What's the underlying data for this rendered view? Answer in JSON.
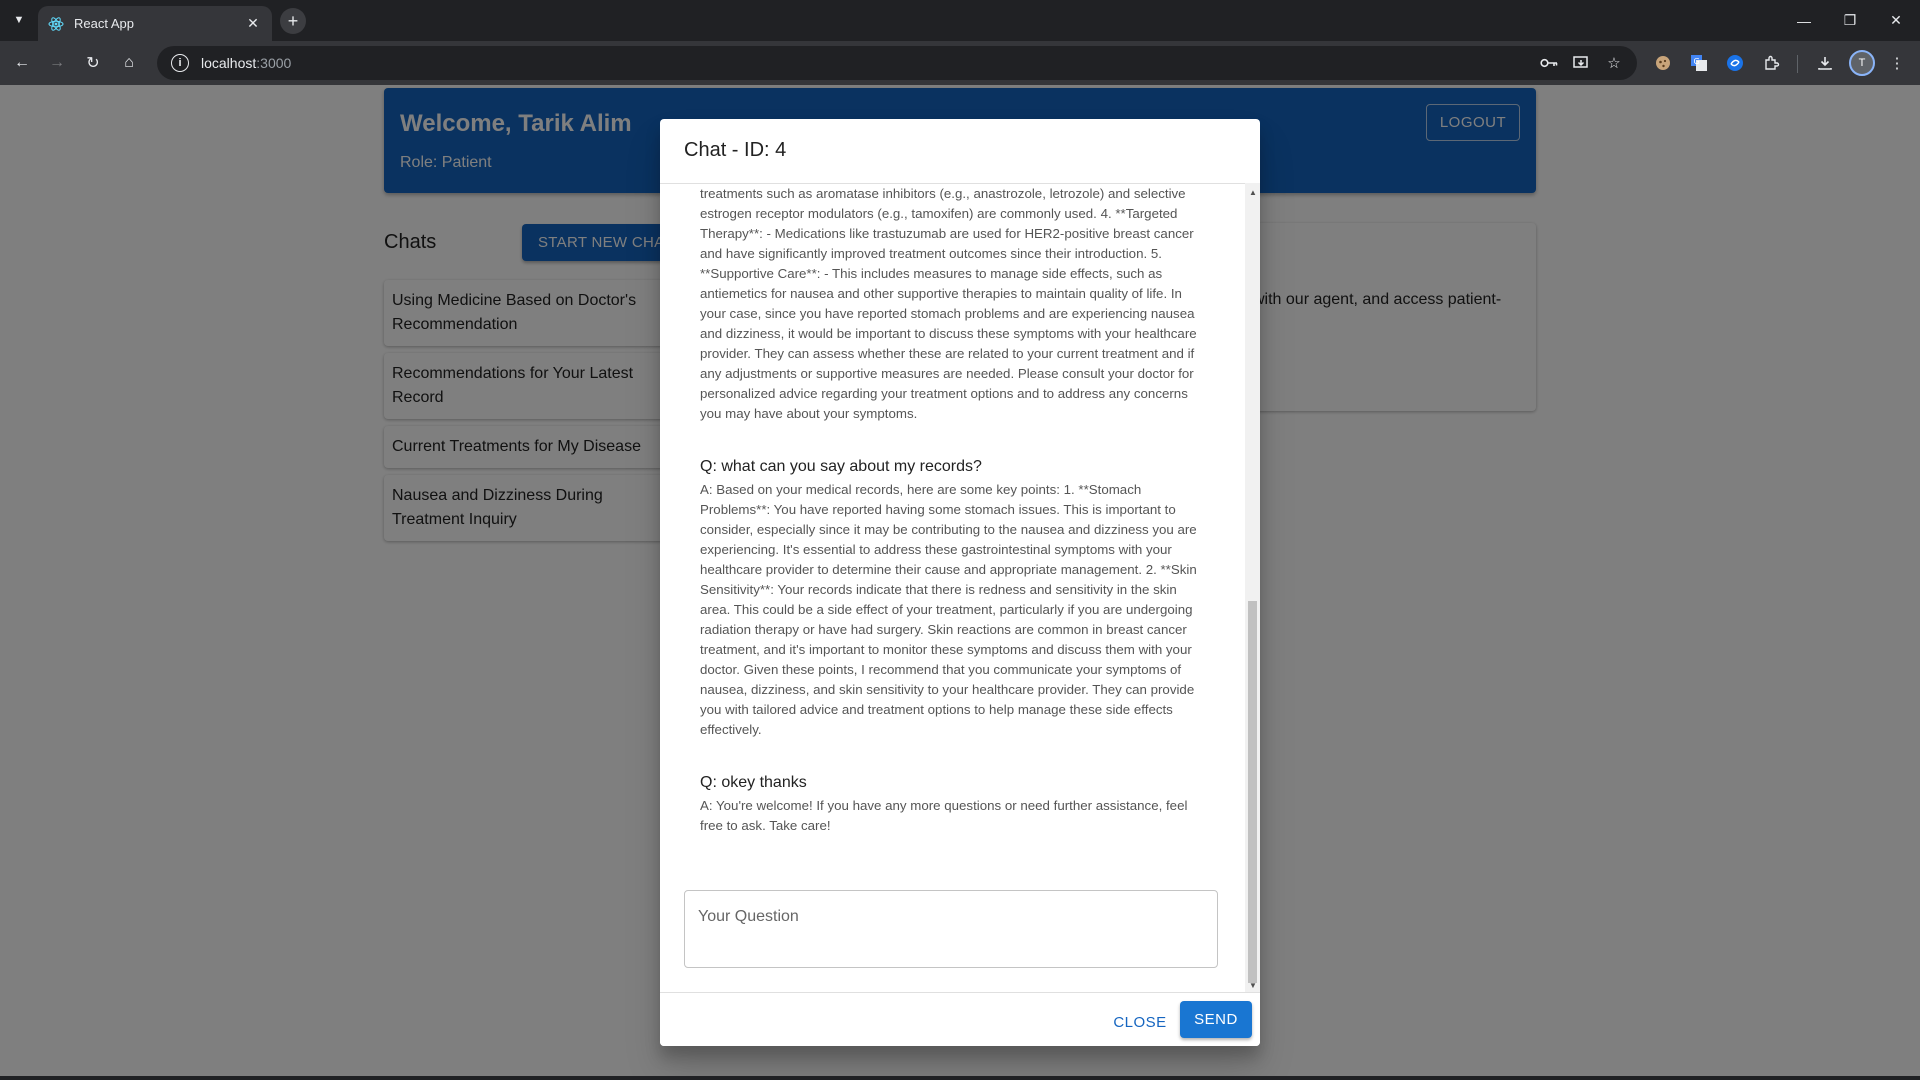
{
  "browser": {
    "tab_title": "React App",
    "url_host": "localhost",
    "url_port": ":3000",
    "profile_initial": "T"
  },
  "header": {
    "welcome": "Welcome, Tarik Alim",
    "role": "Role: Patient",
    "logout_label": "LOGOUT"
  },
  "chats": {
    "title": "Chats",
    "new_chat_label": "START NEW CHAT",
    "items": [
      {
        "label": "Using Medicine Based on Doctor's Recommendation"
      },
      {
        "label": "Recommendations for Your Latest Record"
      },
      {
        "label": "Current Treatments for My Disease"
      },
      {
        "label": "Nausea and Dizziness During Treatment Inquiry"
      }
    ]
  },
  "info_card": {
    "text_fragment": "with our agent, and access patient-"
  },
  "dialog": {
    "title": "Chat - ID: 4",
    "messages": [
      {
        "question": "",
        "answer": "depending on receptor status. For hormone receptor-positive breast cancer, treatments such as aromatase inhibitors (e.g., anastrozole, letrozole) and selective estrogen receptor modulators (e.g., tamoxifen) are commonly used. 4. **Targeted Therapy**: - Medications like trastuzumab are used for HER2-positive breast cancer and have significantly improved treatment outcomes since their introduction. 5. **Supportive Care**: - This includes measures to manage side effects, such as antiemetics for nausea and other supportive therapies to maintain quality of life. In your case, since you have reported stomach problems and are experiencing nausea and dizziness, it would be important to discuss these symptoms with your healthcare provider. They can assess whether these are related to your current treatment and if any adjustments or supportive measures are needed. Please consult your doctor for personalized advice regarding your treatment options and to address any concerns you may have about your symptoms."
      },
      {
        "question": "Q: what can you say about my records?",
        "answer": "A: Based on your medical records, here are some key points: 1. **Stomach Problems**: You have reported having some stomach issues. This is important to consider, especially since it may be contributing to the nausea and dizziness you are experiencing. It's essential to address these gastrointestinal symptoms with your healthcare provider to determine their cause and appropriate management. 2. **Skin Sensitivity**: Your records indicate that there is redness and sensitivity in the skin area. This could be a side effect of your treatment, particularly if you are undergoing radiation therapy or have had surgery. Skin reactions are common in breast cancer treatment, and it's important to monitor these symptoms and discuss them with your doctor. Given these points, I recommend that you communicate your symptoms of nausea, dizziness, and skin sensitivity to your healthcare provider. They can provide you with tailored advice and treatment options to help manage these side effects effectively."
      },
      {
        "question": "Q: okey thanks",
        "answer": "A: You're welcome! If you have any more questions or need further assistance, feel free to ask. Take care!"
      }
    ],
    "question_placeholder": "Your Question",
    "close_label": "CLOSE",
    "send_label": "SEND"
  },
  "colors": {
    "primary": "#1565c0",
    "send": "#1976d2",
    "chrome_dark": "#202124"
  }
}
